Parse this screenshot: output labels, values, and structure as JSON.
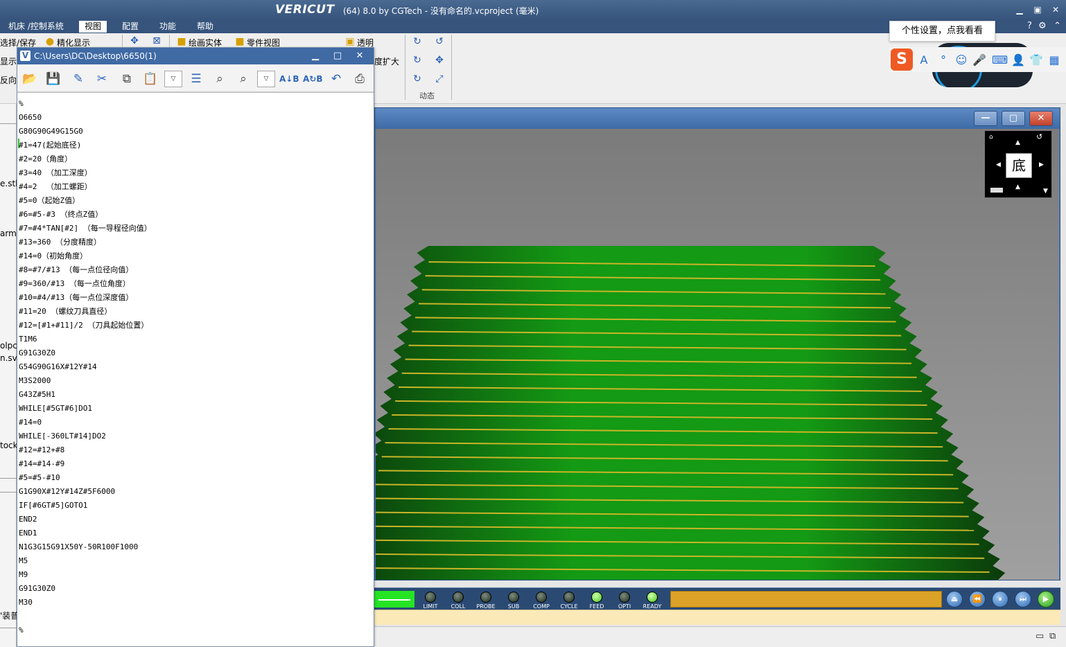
{
  "app": {
    "logo": "VERICUT",
    "title": "(64)  8.0 by CGTech - 没有命名的.vcproject (毫米)",
    "min": "▁",
    "max": "▣",
    "close": "✕"
  },
  "menu": {
    "items": [
      "机床 /控制系统",
      "视图",
      "配置",
      "功能",
      "帮助"
    ],
    "active": "视图",
    "help": "?",
    "settings": "⚙",
    "collapse": "⌃"
  },
  "ribbon": {
    "select_save": "选择/保存",
    "refine_display": "精化显示",
    "draw_solid": "绘画实体",
    "part_view": "零件视图",
    "transparent": "透明",
    "zoom_expand": "度扩大",
    "dynamic_group": "动态",
    "show_partial": "显示",
    "direction_partial": "反向"
  },
  "leftpanel": {
    "items": [
      "e.stl",
      "arm",
      "olpc",
      "n.sv",
      "tock",
      "'装普."
    ]
  },
  "editor": {
    "path": "C:\\Users\\DC\\Desktop\\6650(1)",
    "icon": "V",
    "min": "▁",
    "max": "□",
    "close": "✕",
    "lines": [
      "%",
      "O6650",
      "G80G90G49G15G0",
      "#1=47(起始底径)",
      "#2=20（角度）",
      "#3=40 （加工深度）",
      "#4=2  （加工螺距）",
      "#5=0（起始Z值）",
      "#6=#5-#3 （终点Z值）",
      "#7=#4*TAN[#2] （每一导程径向值）",
      "#13=360 （分度精度）",
      "#14=0（初始角度）",
      "#8=#7/#13 （每一点位径向值）",
      "#9=360/#13 （每一点位角度）",
      "#10=#4/#13（每一点位深度值）",
      "#11=20 （螺纹刀具直径）",
      "#12=[#1+#11]/2 （刀具起始位置）",
      "T1M6",
      "G91G30Z0",
      "G54G90G16X#12Y#14",
      "M3S2000",
      "G43Z#5H1",
      "WHILE[#5GT#6]DO1",
      "#14=0",
      "WHILE[-360LT#14]DO2",
      "#12=#12+#8",
      "#14=#14-#9",
      "#5=#5-#10",
      "G1G90X#12Y#14Z#5F6000",
      "IF[#6GT#5]GOTO1",
      "END2",
      "END1",
      "N1G3G15G91X50Y-50R100F1000",
      "M5",
      "M9",
      "G91G30Z0",
      "M30",
      "",
      "%"
    ]
  },
  "view": {
    "cube_face": "底",
    "min": "—",
    "max": "▢",
    "close": "✕"
  },
  "status": {
    "leds": [
      {
        "label": "LIMIT",
        "on": false
      },
      {
        "label": "COLL",
        "on": false
      },
      {
        "label": "PROBE",
        "on": false
      },
      {
        "label": "SUB",
        "on": false
      },
      {
        "label": "COMP",
        "on": false
      },
      {
        "label": "CYCLE",
        "on": false
      },
      {
        "label": "FEED",
        "on": true
      },
      {
        "label": "OPTI",
        "on": false
      },
      {
        "label": "READY",
        "on": true
      }
    ],
    "progress": 1.0,
    "buttons": [
      "⏏",
      "⏪",
      "⏸",
      "⏭",
      "▶"
    ]
  },
  "ime": {
    "tip": "个性设置，点我看看",
    "logo": "S",
    "icons": [
      "A",
      "°",
      "☺",
      "🎤",
      "⌨",
      "👤",
      "👕",
      "▦"
    ]
  },
  "colors": {
    "thread_dark": "#0b3a0b",
    "thread_green": "#149a14",
    "thread_line": "#c9b52a"
  }
}
